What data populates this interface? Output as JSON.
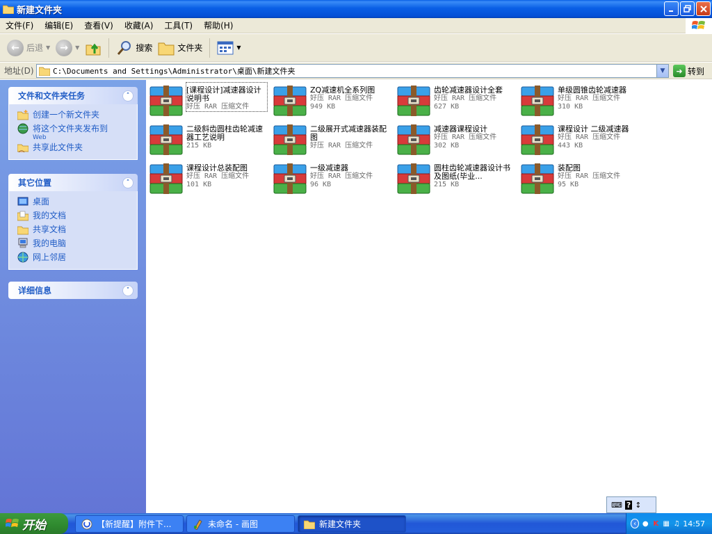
{
  "window": {
    "title": "新建文件夹"
  },
  "menu": {
    "items": [
      {
        "label": "文件(F)"
      },
      {
        "label": "编辑(E)"
      },
      {
        "label": "查看(V)"
      },
      {
        "label": "收藏(A)"
      },
      {
        "label": "工具(T)"
      },
      {
        "label": "帮助(H)"
      }
    ]
  },
  "toolbar": {
    "back_label": "后退",
    "search_label": "搜索",
    "folders_label": "文件夹"
  },
  "address": {
    "label": "地址(D)",
    "path": "C:\\Documents and Settings\\Administrator\\桌面\\新建文件夹",
    "go_label": "转到"
  },
  "sidebar": {
    "tasks": {
      "title": "文件和文件夹任务",
      "items": [
        {
          "label": "创建一个新文件夹"
        },
        {
          "label": "将这个文件夹发布到",
          "sub": "Web"
        },
        {
          "label": "共享此文件夹"
        }
      ]
    },
    "places": {
      "title": "其它位置",
      "items": [
        {
          "label": "桌面"
        },
        {
          "label": "我的文档"
        },
        {
          "label": "共享文档"
        },
        {
          "label": "我的电脑"
        },
        {
          "label": "网上邻居"
        }
      ]
    },
    "details": {
      "title": "详细信息"
    }
  },
  "files": [
    {
      "name": "[课程设计]减速器设计说明书",
      "type": "好压 RAR 压缩文件",
      "size": ""
    },
    {
      "name": "ZQ减速机全系列图",
      "type": "好压 RAR 压缩文件",
      "size": "949 KB"
    },
    {
      "name": "齿轮减速器设计全套",
      "type": "好压 RAR 压缩文件",
      "size": "627 KB"
    },
    {
      "name": "单级圆锥齿轮减速器",
      "type": "好压 RAR 压缩文件",
      "size": "310 KB"
    },
    {
      "name": "二级斜齿圆柱齿轮减速器工艺说明",
      "type": "",
      "size": "215 KB"
    },
    {
      "name": "二级展开式减速器装配图",
      "type": "好压 RAR 压缩文件",
      "size": ""
    },
    {
      "name": "减速器课程设计",
      "type": "好压 RAR 压缩文件",
      "size": "302 KB"
    },
    {
      "name": "课程设计 二级减速器",
      "type": "好压 RAR 压缩文件",
      "size": "443 KB"
    },
    {
      "name": "课程设计总装配图",
      "type": "好压 RAR 压缩文件",
      "size": "101 KB"
    },
    {
      "name": "一级减速器",
      "type": "好压 RAR 压缩文件",
      "size": "96 KB"
    },
    {
      "name": "圆柱齿轮减速器设计书及图纸(毕业...",
      "type": "",
      "size": "215 KB"
    },
    {
      "name": "装配图",
      "type": "好压 RAR 压缩文件",
      "size": "95 KB"
    }
  ],
  "taskbar": {
    "start_label": "开始",
    "buttons": [
      {
        "label": "【新提醒】附件下..."
      },
      {
        "label": "未命名 - 画图"
      },
      {
        "label": "新建文件夹"
      }
    ],
    "clock": "14:57"
  }
}
